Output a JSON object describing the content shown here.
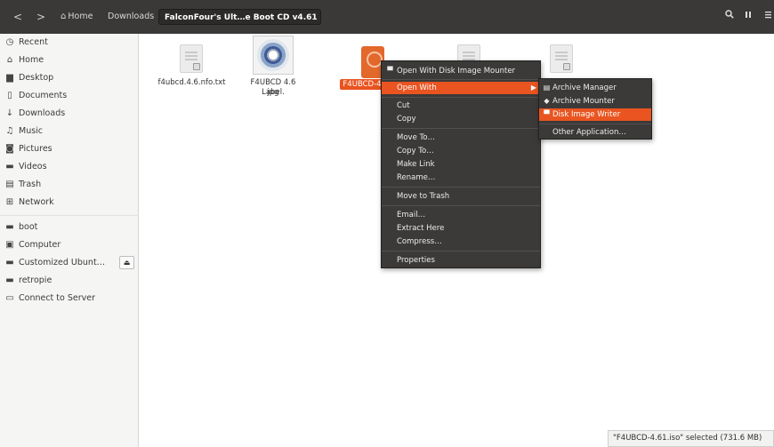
{
  "header": {
    "back_glyph": "<",
    "forward_glyph": ">",
    "home_icon": "home-icon",
    "crumbs": [
      "Home",
      "Downloads",
      "FalconFour's Ult…e Boot CD v4.61"
    ],
    "search_icon": "search-icon",
    "view_icon": "view-options-icon",
    "menu_icon": "menu-icon"
  },
  "sidebar": {
    "items": [
      {
        "label": "Recent",
        "icon": "clock-icon"
      },
      {
        "label": "Home",
        "icon": "home-icon"
      },
      {
        "label": "Desktop",
        "icon": "desktop-folder-icon"
      },
      {
        "label": "Documents",
        "icon": "documents-icon"
      },
      {
        "label": "Downloads",
        "icon": "download-icon"
      },
      {
        "label": "Music",
        "icon": "music-icon"
      },
      {
        "label": "Pictures",
        "icon": "camera-icon"
      },
      {
        "label": "Videos",
        "icon": "video-icon"
      },
      {
        "label": "Trash",
        "icon": "trash-icon"
      },
      {
        "label": "Network",
        "icon": "network-icon"
      }
    ],
    "devices": [
      {
        "label": "boot",
        "icon": "drive-icon"
      },
      {
        "label": "Computer",
        "icon": "computer-icon"
      },
      {
        "label": "Customized Ubunt…",
        "icon": "drive-icon"
      },
      {
        "label": "retropie",
        "icon": "drive-icon"
      },
      {
        "label": "Connect to Server",
        "icon": "server-icon"
      }
    ],
    "eject_glyph": "⏏"
  },
  "files": [
    {
      "name": "f4ubcd.4.6.nfo.txt",
      "type": "text-document"
    },
    {
      "name_line1": "F4UBCD 4.6 Label.",
      "name_line2": "jpg",
      "type": "image"
    },
    {
      "name": "F4UBCD-4",
      "type": "disk-image",
      "selected": true
    },
    {
      "name": "",
      "type": "document"
    },
    {
      "name": "",
      "type": "document"
    }
  ],
  "context_menu": {
    "top_item": "Open With Disk Image Mounter",
    "open_with": "Open With",
    "cut": "Cut",
    "copy": "Copy",
    "move_to": "Move To…",
    "copy_to": "Copy To…",
    "make_link": "Make Link",
    "rename": "Rename…",
    "move_to_trash": "Move to Trash",
    "email": "Email…",
    "extract_here": "Extract Here",
    "compress": "Compress…",
    "properties": "Properties"
  },
  "submenu": {
    "archive_manager": "Archive Manager",
    "archive_mounter": "Archive Mounter",
    "disk_image_writer": "Disk Image Writer",
    "other_application": "Other Application…"
  },
  "status": {
    "text": "\"F4UBCD-4.61.iso\" selected (731.6 MB)"
  },
  "colors": {
    "accent": "#e95420",
    "header_bg": "#3a3937",
    "menu_bg": "#3b3a39",
    "sidebar_bg": "#f5f5f4"
  }
}
